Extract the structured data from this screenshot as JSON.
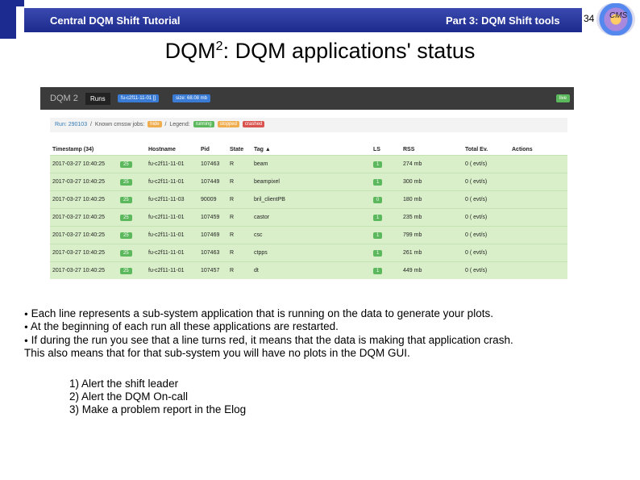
{
  "slide": {
    "header_left": "Central DQM Shift Tutorial",
    "header_right": "Part 3: DQM Shift tools",
    "page_number": "34",
    "logo_text": "CMS",
    "title_main": "DQM",
    "title_sup": "2",
    "title_rest": ":  DQM applications' status"
  },
  "dqm_gui": {
    "logo": "DQM 2",
    "nav_runs": "Runs",
    "host_pill": "fu-c2f11-11-01 []",
    "size_pill": "size: 68.08 mb",
    "live_label": "live",
    "breadcrumb_run": "Run: 290103",
    "breadcrumb_known": "Known cmssw jobs:",
    "hide_label": "hide",
    "legend_label": "Legend:",
    "legend_running": "running",
    "legend_stopped": "stopped",
    "legend_crashed": "crashed",
    "status_colors": {
      "hide": "#f0ad4e",
      "running": "#5cb85c",
      "stopped": "#f0ad4e",
      "crashed": "#d9534f"
    },
    "columns": [
      "Timestamp (34)",
      "Hostname",
      "Pid",
      "State",
      "Tag ▲",
      "LS",
      "RSS",
      "Total Ev.",
      "Actions"
    ],
    "rows": [
      {
        "timestamp": "2017-03-27 10:40:25",
        "age": "25",
        "hostname": "fu-c2f11-11-01",
        "pid": "107463",
        "state": "R",
        "tag": "beam",
        "ls": "1",
        "rss": "274 mb",
        "total": "0 ( evt/s)"
      },
      {
        "timestamp": "2017-03-27 10:40:25",
        "age": "25",
        "hostname": "fu-c2f11-11-01",
        "pid": "107449",
        "state": "R",
        "tag": "beampixel",
        "ls": "1",
        "rss": "300 mb",
        "total": "0 ( evt/s)"
      },
      {
        "timestamp": "2017-03-27 10:40:25",
        "age": "25",
        "hostname": "fu-c2f11-11-03",
        "pid": "90009",
        "state": "R",
        "tag": "bril_clientPB",
        "ls": "0",
        "rss": "180 mb",
        "total": "0 ( evt/s)"
      },
      {
        "timestamp": "2017-03-27 10:40:25",
        "age": "25",
        "hostname": "fu-c2f11-11-01",
        "pid": "107459",
        "state": "R",
        "tag": "castor",
        "ls": "1",
        "rss": "235 mb",
        "total": "0 ( evt/s)"
      },
      {
        "timestamp": "2017-03-27 10:40:25",
        "age": "25",
        "hostname": "fu-c2f11-11-01",
        "pid": "107469",
        "state": "R",
        "tag": "csc",
        "ls": "1",
        "rss": "799 mb",
        "total": "0 ( evt/s)"
      },
      {
        "timestamp": "2017-03-27 10:40:25",
        "age": "25",
        "hostname": "fu-c2f11-11-01",
        "pid": "107463",
        "state": "R",
        "tag": "ctpps",
        "ls": "1",
        "rss": "261 mb",
        "total": "0 ( evt/s)"
      },
      {
        "timestamp": "2017-03-27 10:40:25",
        "age": "25",
        "hostname": "fu-c2f11-11-01",
        "pid": "107457",
        "state": "R",
        "tag": "dt",
        "ls": "1",
        "rss": "449 mb",
        "total": "0 ( evt/s)"
      }
    ]
  },
  "body": {
    "bullets": [
      "Each line represents a sub-system application that is running on the data to generate your plots.",
      "At the beginning of each run all these applications are restarted.",
      "If during the run you see that a line turns red, it means that the data is making that application crash."
    ],
    "note": "This also means that for that sub-system you will have no plots in the DQM GUI.",
    "steps": [
      "1) Alert the shift leader",
      "2) Alert the DQM On-call",
      "3) Make a problem report in the Elog"
    ]
  }
}
